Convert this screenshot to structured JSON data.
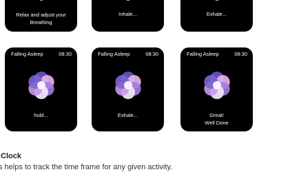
{
  "screens_top": [
    {
      "caption_lines": [
        "Relax and adjust your",
        "Breathing"
      ]
    },
    {
      "caption_lines": [
        "Inhale..."
      ]
    },
    {
      "caption_lines": [
        "Exhale..."
      ]
    }
  ],
  "screens_bottom": [
    {
      "title": "Falling Asleep",
      "time": "08:30",
      "caption_lines": [
        "hold..."
      ]
    },
    {
      "title": "Falling Asleep",
      "time": "08:30",
      "caption_lines": [
        "Exhale..."
      ]
    },
    {
      "title": "Falling Asleep",
      "time": "08:30",
      "caption_lines": [
        "Great!",
        "Well Done"
      ]
    }
  ],
  "section": {
    "title": "Clock",
    "description": "s helps to track the time frame for any given activity."
  },
  "colors": {
    "watch_bg": "#000000",
    "petal_purple": "#6a55c8",
    "petal_lavender": "#b69be6",
    "petal_pink": "#e7b6ec",
    "petal_light": "#efe4fb"
  }
}
